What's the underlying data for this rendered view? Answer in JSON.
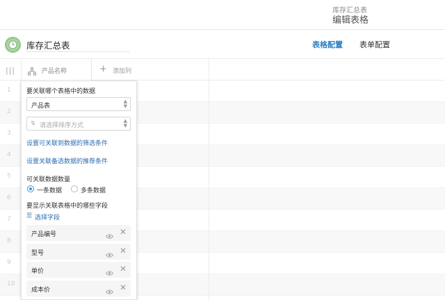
{
  "header": {
    "breadcrumb_sub": "库存汇总表",
    "breadcrumb_main": "编辑表格"
  },
  "toolbar": {
    "sheet_title": "库存汇总表",
    "tabs": [
      {
        "label": "表格配置",
        "active": true
      },
      {
        "label": "表单配置",
        "active": false
      }
    ],
    "accent_color": "#2a7fc2"
  },
  "grid": {
    "columns": [
      {
        "label": "产品名称",
        "icon": "tree-icon"
      }
    ],
    "add_column_label": "添加列",
    "row_numbers": [
      "1",
      "2",
      "3",
      "4",
      "5",
      "6",
      "7",
      "8",
      "9",
      "10"
    ]
  },
  "popup": {
    "link_table_label": "要关联哪个表格中的数据",
    "table_select_value": "产品表",
    "sort_placeholder": "请选择排序方式",
    "filter_link": "设置可关联到数据的筛选条件",
    "recommend_link": "设置关联备选数据的推荐条件",
    "quantity_label": "可关联数据数量",
    "radio_options": [
      {
        "label": "一条数据",
        "selected": true
      },
      {
        "label": "多条数据",
        "selected": false
      }
    ],
    "display_fields_label": "要显示关联表格中的哪些字段",
    "select_fields_link": "选择字段",
    "fields": [
      "产品编号",
      "型号",
      "单价",
      "成本价"
    ]
  }
}
